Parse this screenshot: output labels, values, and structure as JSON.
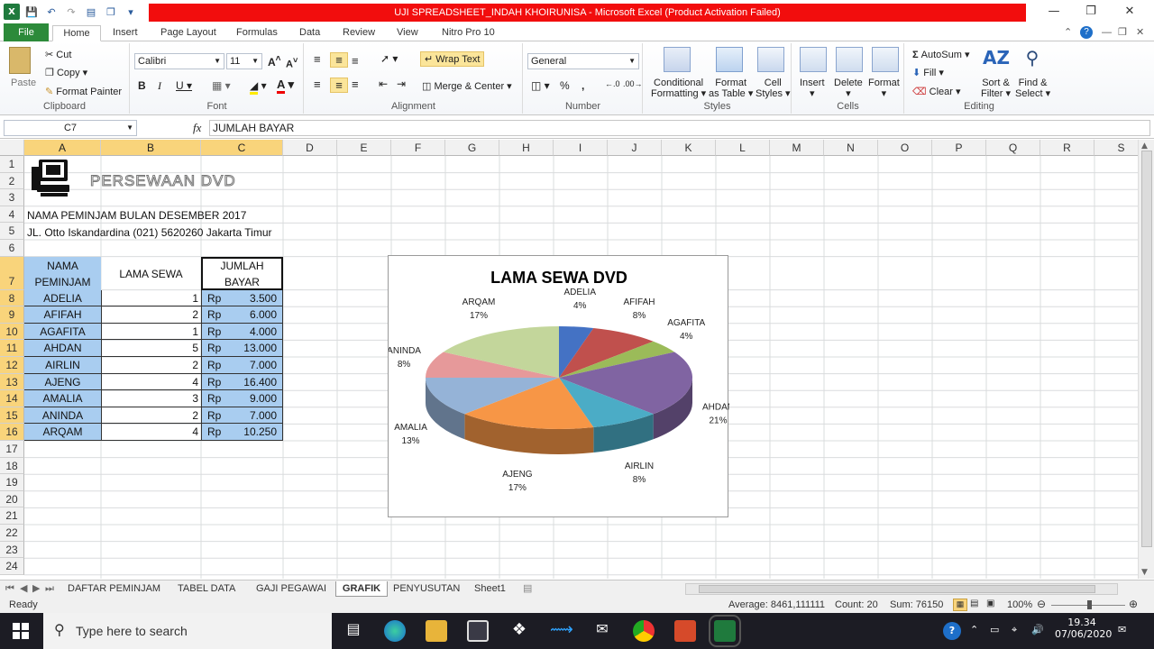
{
  "window": {
    "title": "UJI SPREADSHEET_INDAH KHOIRUNISA  -  Microsoft Excel (Product Activation Failed)"
  },
  "ribbon_tabs": [
    "File",
    "Home",
    "Insert",
    "Page Layout",
    "Formulas",
    "Data",
    "Review",
    "View",
    "Nitro Pro 10"
  ],
  "ribbon": {
    "clipboard": {
      "paste": "Paste",
      "cut": "Cut",
      "copy": "Copy",
      "format_painter": "Format Painter",
      "label": "Clipboard"
    },
    "font": {
      "name": "Calibri",
      "size": "11",
      "label": "Font"
    },
    "alignment": {
      "wrap_text": "Wrap Text",
      "merge_center": "Merge & Center",
      "label": "Alignment"
    },
    "number": {
      "format": "General",
      "label": "Number"
    },
    "styles": {
      "conditional": "Conditional",
      "conditional2": "Formatting",
      "format_as": "Format",
      "format_as2": "as Table",
      "cell": "Cell",
      "cell2": "Styles",
      "label": "Styles"
    },
    "cells": {
      "insert": "Insert",
      "delete": "Delete",
      "format": "Format",
      "label": "Cells"
    },
    "editing": {
      "autosum": "AutoSum",
      "fill": "Fill",
      "clear": "Clear",
      "sort": "Sort &",
      "sort2": "Filter",
      "find": "Find &",
      "find2": "Select",
      "label": "Editing"
    }
  },
  "formula_bar": {
    "name_box": "C7",
    "fx": "fx",
    "content": "JUMLAH BAYAR"
  },
  "columns": [
    "A",
    "B",
    "C",
    "D",
    "E",
    "F",
    "G",
    "H",
    "I",
    "J",
    "K",
    "L",
    "M",
    "N",
    "O",
    "P",
    "Q",
    "R",
    "S"
  ],
  "rows": [
    "1",
    "2",
    "3",
    "4",
    "5",
    "6",
    "7",
    "8",
    "9",
    "10",
    "11",
    "12",
    "13",
    "14",
    "15",
    "16",
    "17",
    "18",
    "19",
    "20",
    "21",
    "22",
    "23",
    "24"
  ],
  "sheet": {
    "logo_text": "PERSEWAAN DVD",
    "line1": "NAMA PEMINJAM BULAN DESEMBER 2017",
    "line2": "JL. Otto Iskandardina (021) 5620260 Jakarta Timur",
    "header_a1": "NAMA",
    "header_a2": "PEMINJAM",
    "header_b": "LAMA SEWA",
    "header_c1": "JUMLAH",
    "header_c2": "BAYAR",
    "currency": "Rp",
    "table": [
      {
        "name": "ADELIA",
        "lama": "1",
        "bayar": "3.500"
      },
      {
        "name": "AFIFAH",
        "lama": "2",
        "bayar": "6.000"
      },
      {
        "name": "AGAFITA",
        "lama": "1",
        "bayar": "4.000"
      },
      {
        "name": "AHDAN",
        "lama": "5",
        "bayar": "13.000"
      },
      {
        "name": "AIRLIN",
        "lama": "2",
        "bayar": "7.000"
      },
      {
        "name": "AJENG",
        "lama": "4",
        "bayar": "16.400"
      },
      {
        "name": "AMALIA",
        "lama": "3",
        "bayar": "9.000"
      },
      {
        "name": "ANINDA",
        "lama": "2",
        "bayar": "7.000"
      },
      {
        "name": "ARQAM",
        "lama": "4",
        "bayar": "10.250"
      }
    ]
  },
  "chart_data": {
    "type": "pie",
    "title": "LAMA SEWA DVD",
    "categories": [
      "ADELIA",
      "AFIFAH",
      "AGAFITA",
      "AHDAN",
      "AIRLIN",
      "AJENG",
      "AMALIA",
      "ANINDA",
      "ARQAM"
    ],
    "values": [
      1,
      2,
      1,
      5,
      2,
      4,
      3,
      2,
      4
    ],
    "percent_labels": [
      "4%",
      "8%",
      "4%",
      "21%",
      "8%",
      "17%",
      "13%",
      "8%",
      "17%"
    ],
    "colors": [
      "#4472c4",
      "#c0504d",
      "#9bbb59",
      "#8064a2",
      "#4bacc6",
      "#f79646",
      "#95b3d7",
      "#e6999a",
      "#c3d69b"
    ]
  },
  "sheet_tabs": [
    "DAFTAR PEMINJAM",
    "TABEL DATA",
    "GAJI PEGAWAI",
    "GRAFIK",
    "PENYUSUTAN",
    "Sheet1"
  ],
  "active_sheet": "GRAFIK",
  "status": {
    "mode": "Ready",
    "average": "Average: 8461,111111",
    "count": "Count: 20",
    "sum": "Sum: 76150",
    "zoom": "100%"
  },
  "taskbar": {
    "search": "Type here to search",
    "time": "19.34",
    "date": "07/06/2020"
  }
}
